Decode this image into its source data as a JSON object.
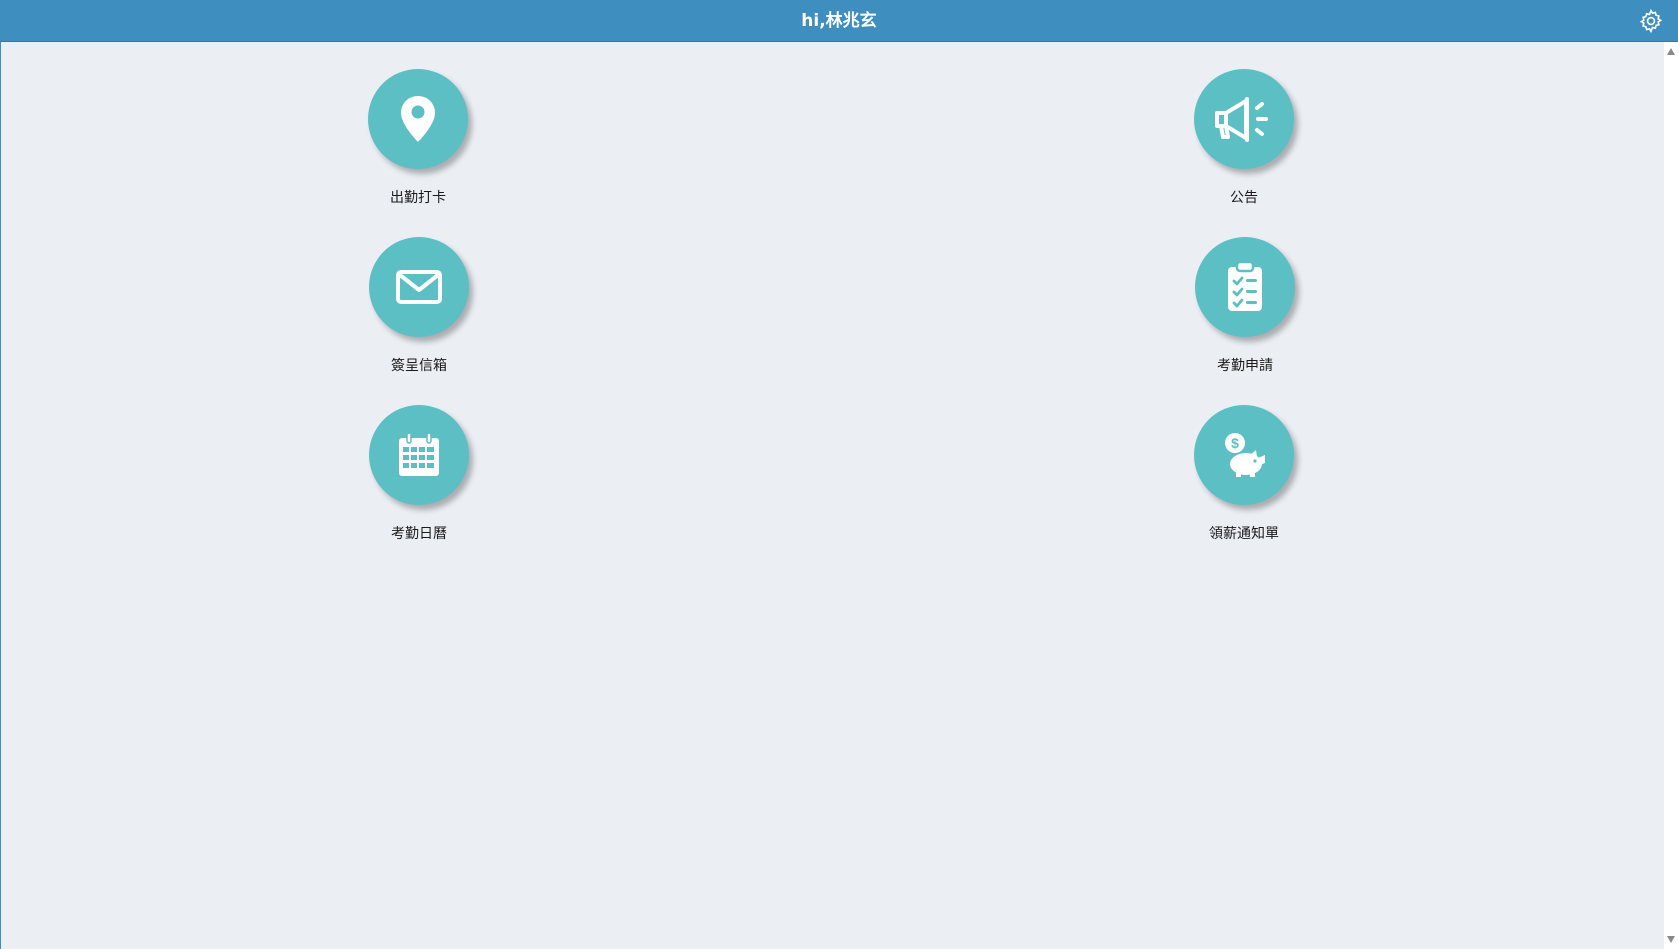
{
  "header": {
    "title": "hi,林兆玄",
    "settings_icon": "gear-icon"
  },
  "tiles": [
    {
      "label": "出勤打卡",
      "icon": "map-pin-icon"
    },
    {
      "label": "公告",
      "icon": "megaphone-icon"
    },
    {
      "label": "簽呈信箱",
      "icon": "envelope-icon"
    },
    {
      "label": "考勤申請",
      "icon": "clipboard-checklist-icon"
    },
    {
      "label": "考勤日曆",
      "icon": "calendar-icon"
    },
    {
      "label": "領薪通知單",
      "icon": "piggy-bank-icon"
    }
  ],
  "colors": {
    "header_bg": "#3e8ebf",
    "content_bg": "#ebeff4",
    "tile_circle": "#5bbfc4"
  }
}
